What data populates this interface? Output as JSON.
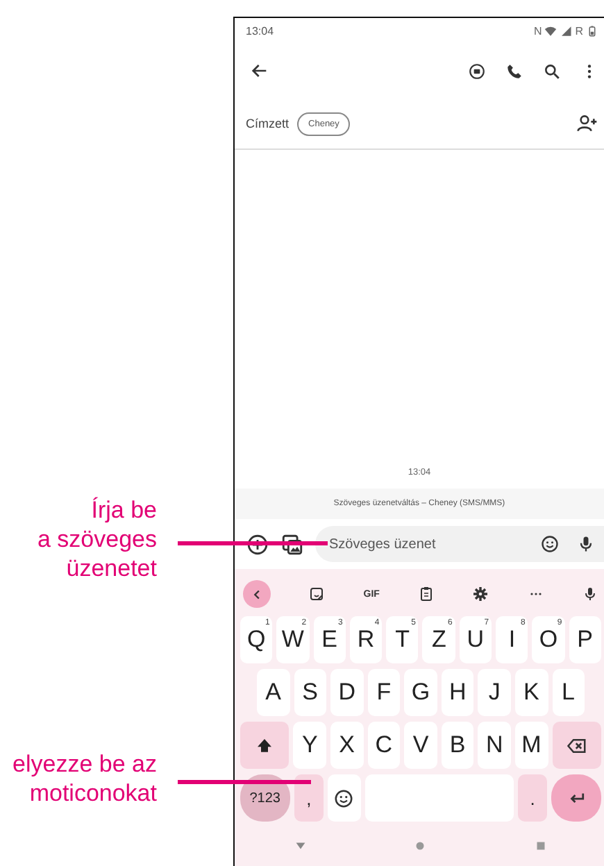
{
  "status_bar": {
    "time": "13:04",
    "indicators": [
      "N",
      "R"
    ]
  },
  "recipient": {
    "label": "Címzett",
    "chip": "Cheney"
  },
  "conversation": {
    "timestamp": "13:04",
    "info": "Szöveges üzenetváltás – Cheney (SMS/MMS)"
  },
  "composer": {
    "placeholder": "Szöveges üzenet"
  },
  "keyboard": {
    "toolbar": [
      {
        "kind": "back"
      },
      {
        "kind": "sticker"
      },
      {
        "kind": "gif",
        "label": "GIF"
      },
      {
        "kind": "clipboard"
      },
      {
        "kind": "settings"
      },
      {
        "kind": "more"
      },
      {
        "kind": "mic"
      }
    ],
    "rows": [
      [
        {
          "kind": "char",
          "label": "Q",
          "hint": "1"
        },
        {
          "kind": "char",
          "label": "W",
          "hint": "2"
        },
        {
          "kind": "char",
          "label": "E",
          "hint": "3"
        },
        {
          "kind": "char",
          "label": "R",
          "hint": "4"
        },
        {
          "kind": "char",
          "label": "T",
          "hint": "5"
        },
        {
          "kind": "char",
          "label": "Z",
          "hint": "6"
        },
        {
          "kind": "char",
          "label": "U",
          "hint": "7"
        },
        {
          "kind": "char",
          "label": "I",
          "hint": "8"
        },
        {
          "kind": "char",
          "label": "O",
          "hint": "9"
        },
        {
          "kind": "char",
          "label": "P"
        }
      ],
      [
        {
          "kind": "char",
          "label": "A"
        },
        {
          "kind": "char",
          "label": "S"
        },
        {
          "kind": "char",
          "label": "D"
        },
        {
          "kind": "char",
          "label": "F"
        },
        {
          "kind": "char",
          "label": "G"
        },
        {
          "kind": "char",
          "label": "H"
        },
        {
          "kind": "char",
          "label": "J"
        },
        {
          "kind": "char",
          "label": "K"
        },
        {
          "kind": "char",
          "label": "L"
        }
      ],
      [
        {
          "kind": "shift"
        },
        {
          "kind": "char",
          "label": "Y"
        },
        {
          "kind": "char",
          "label": "X"
        },
        {
          "kind": "char",
          "label": "C"
        },
        {
          "kind": "char",
          "label": "V"
        },
        {
          "kind": "char",
          "label": "B"
        },
        {
          "kind": "char",
          "label": "N"
        },
        {
          "kind": "char",
          "label": "M"
        },
        {
          "kind": "backspace"
        }
      ]
    ],
    "bottom_row": [
      {
        "kind": "symbols",
        "label": "?123"
      },
      {
        "kind": "punct",
        "label": ","
      },
      {
        "kind": "emoji"
      },
      {
        "kind": "space"
      },
      {
        "kind": "punct",
        "label": "."
      },
      {
        "kind": "enter"
      }
    ]
  },
  "callouts": [
    {
      "text": "Írja be\na szöveges\nüzenetet"
    },
    {
      "text": "elyezze be az\nmoticonokat"
    }
  ]
}
